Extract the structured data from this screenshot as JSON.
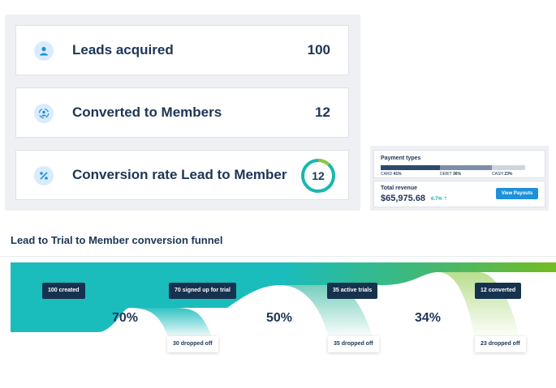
{
  "stats": {
    "leads": {
      "label": "Leads acquired",
      "value": "100",
      "icon": "person-icon"
    },
    "converted": {
      "label": "Converted to Members",
      "value": "12",
      "icon": "member-icon"
    },
    "conversion": {
      "label": "Conversion rate Lead to Member",
      "value": "12",
      "icon": "percent-icon",
      "ring_fraction": 0.12
    }
  },
  "payment": {
    "title": "Payment types",
    "segments": [
      {
        "label": "CARD",
        "percent_label": "41%",
        "share": 41,
        "color": "#2e4a6b"
      },
      {
        "label": "DEBIT",
        "percent_label": "36%",
        "share": 36,
        "color": "#7d8fa6"
      },
      {
        "label": "CASH",
        "percent_label": "23%",
        "share": 23,
        "color": "#cdd6e0"
      }
    ],
    "revenue_label": "Total revenue",
    "revenue_amount": "$65,975.68",
    "revenue_change": "6.7% ⇡",
    "payouts_button": "View Payouts"
  },
  "funnel": {
    "title": "Lead to Trial to Member conversion funnel",
    "stages": [
      {
        "label": "100 created",
        "count": 100
      },
      {
        "label": "70 signed up for trial",
        "count": 70
      },
      {
        "label": "35 active trials",
        "count": 35
      },
      {
        "label": "12 converted",
        "count": 12
      }
    ],
    "rates": [
      "70%",
      "50%",
      "34%"
    ],
    "drops": [
      "30 dropped off",
      "35 dropped off",
      "23 dropped off"
    ]
  },
  "colors": {
    "teal": "#1bbcbc",
    "green": "#72bd20",
    "navy": "#17324f",
    "ring_track": "#19b7b0",
    "ring_arc": "#8cc63f"
  }
}
